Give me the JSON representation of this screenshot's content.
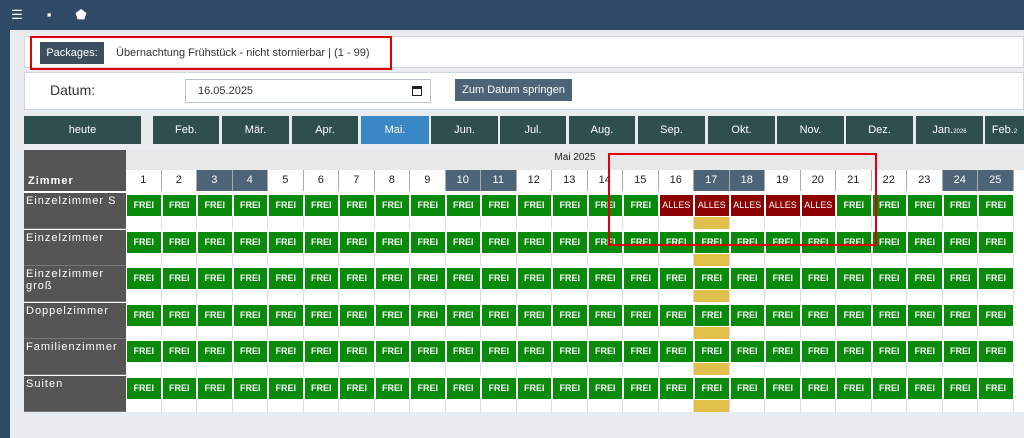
{
  "packages": {
    "label": "Packages:",
    "value": "Übernachtung Frühstück - nicht stornierbar | (1 - 99)"
  },
  "datum": {
    "label": "Datum:",
    "value": "16.05.2025",
    "jump_label": "Zum Datum springen"
  },
  "months": [
    {
      "label": "heute"
    },
    {
      "label": "Feb."
    },
    {
      "label": "Mär."
    },
    {
      "label": "Apr."
    },
    {
      "label": "Mai.",
      "active": true
    },
    {
      "label": "Jun."
    },
    {
      "label": "Jul."
    },
    {
      "label": "Aug."
    },
    {
      "label": "Sep."
    },
    {
      "label": "Okt."
    },
    {
      "label": "Nov."
    },
    {
      "label": "Dez."
    },
    {
      "label": "Jan.",
      "suffix": "2026"
    },
    {
      "label": "Feb.",
      "suffix": "2"
    }
  ],
  "grid": {
    "corner": "Zimmer",
    "month_title": "Mai 2025",
    "days": [
      "1",
      "2",
      "3",
      "4",
      "5",
      "6",
      "7",
      "8",
      "9",
      "10",
      "11",
      "12",
      "13",
      "14",
      "15",
      "16",
      "17",
      "18",
      "19",
      "20",
      "21",
      "22",
      "23",
      "24",
      "25"
    ],
    "weekend_days": [
      "3",
      "4",
      "10",
      "11",
      "17",
      "18",
      "24",
      "25"
    ],
    "today": "17",
    "rooms": [
      {
        "name": "Einzelzimmer S",
        "alles_days": [
          "16",
          "17",
          "18",
          "19",
          "20"
        ]
      },
      {
        "name": "Einzelzimmer",
        "alles_days": []
      },
      {
        "name": "Einzelzimmer groß",
        "alles_days": []
      },
      {
        "name": "Doppelzimmer",
        "alles_days": []
      },
      {
        "name": "Familienzimmer",
        "alles_days": []
      },
      {
        "name": "Suiten",
        "alles_days": []
      }
    ],
    "free_label": "FREI",
    "full_label": "ALLES"
  },
  "colors": {
    "free": "#0a8a0a",
    "full": "#8b0000",
    "today_column": "#e0c04a",
    "highlight": "#e0000b"
  }
}
